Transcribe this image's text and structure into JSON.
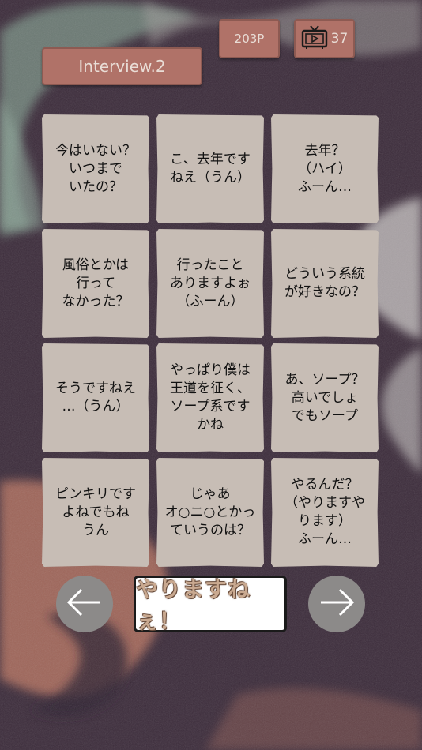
{
  "header": {
    "interview_label": "Interview.2",
    "points_label": "203P",
    "tv_count": "37"
  },
  "cards": [
    "今はいない？\nいつまで\nいたの？",
    "こ、去年です\nねえ（うん）",
    "去年？\n（ハイ）\nふーん…",
    "風俗とかは\n行って\nなかった？",
    "行ったこと\nありますよぉ\n（ふーん）",
    "どういう系統\nが好きなの？",
    "そうですねえ\n…（うん）",
    "やっぱり僕は\n王道を征く、\nソープ系です\nかね",
    "あ、ソープ？\n高いでしょ\nでもソープ",
    "ピンキリです\nよねでもね\nうん",
    "じゃあ\nオ○ニ○とかっ\nていうのは？",
    "やるんだ？\n（やりますや\nります）\nふーん…"
  ],
  "answer_label": "やりますねぇ！",
  "icons": {
    "tv": "tv-icon",
    "left": "arrow-left-icon",
    "right": "arrow-right-icon"
  },
  "colors": {
    "background": "#3b2b3a",
    "button": "#b07268",
    "card": "#c7bdb5",
    "arrow_circle": "#8c8a89"
  }
}
